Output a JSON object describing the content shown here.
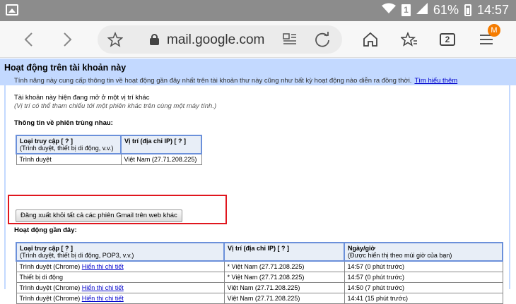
{
  "statusbar": {
    "battery": "61%",
    "time": "14:57",
    "sim": "1"
  },
  "browser": {
    "url": "mail.google.com",
    "tab_count": "2",
    "menu_badge": "M"
  },
  "header": {
    "title": "Hoạt động trên tài khoản này",
    "desc": "Tính năng này cung cấp thông tin về hoạt động gần đây nhất trên tài khoản thư này cũng như bất kỳ hoạt động nào diễn ra đồng thời.",
    "learn_more": "Tìm hiểu thêm"
  },
  "open_sessions": {
    "line1": "Tài khoản này hiện đang mở ở một vị trí khác",
    "line2": "(Vị trí có thể tham chiếu tới một phiên khác trên cùng một máy tính.)",
    "heading": "Thông tin về phiên trùng nhau:",
    "col_access": "Loại truy cập [ ? ]",
    "col_access_sub": "(Trình duyệt, thiết bị di động, v.v.)",
    "col_location": "Vị trí (địa chỉ IP) [ ? ]",
    "row_access": "Trình duyệt",
    "row_location": "Việt Nam (27.71.208.225)",
    "signout_button": "Đăng xuất khỏi tất cả các phiên Gmail trên web khác"
  },
  "recent": {
    "heading": "Hoạt động gần đây:",
    "col_access": "Loại truy cập [ ? ]",
    "col_access_sub": "(Trình duyệt, thiết bị di động, POP3, v.v.)",
    "col_location": "Vị trí (địa chỉ IP) [ ? ]",
    "col_time": "Ngày/giờ",
    "col_time_sub": "(Được hiển thị theo múi giờ của bạn)",
    "details_link": "Hiển thị chi tiết",
    "rows": [
      {
        "access": "Trình duyệt (Chrome)",
        "has_details": true,
        "location": "* Việt Nam (27.71.208.225)",
        "time": "14:57 (0 phút trước)"
      },
      {
        "access": "Thiết bị di động",
        "has_details": false,
        "location": "* Việt Nam (27.71.208.225)",
        "time": "14:57 (0 phút trước)"
      },
      {
        "access": "Trình duyệt (Chrome)",
        "has_details": true,
        "location": "Việt Nam (27.71.208.225)",
        "time": "14:50 (7 phút trước)"
      },
      {
        "access": "Trình duyệt (Chrome)",
        "has_details": true,
        "location": "Việt Nam (27.71.208.225)",
        "time": "14:41 (15 phút trước)"
      }
    ]
  }
}
